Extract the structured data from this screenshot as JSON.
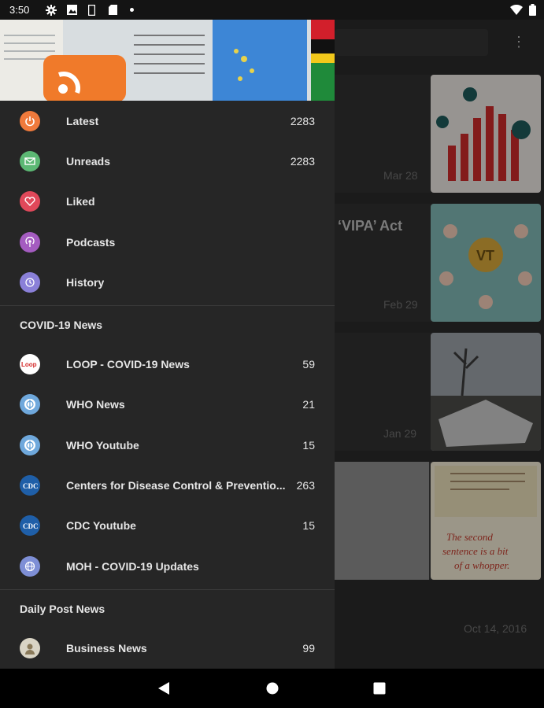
{
  "status": {
    "time": "3:50"
  },
  "menu": [
    {
      "label": "Latest",
      "count": "2283",
      "icon": "power-icon",
      "color": "#f07a3c"
    },
    {
      "label": "Unreads",
      "count": "2283",
      "icon": "envelope-icon",
      "color": "#5cb874"
    },
    {
      "label": "Liked",
      "count": "",
      "icon": "heart-icon",
      "color": "#e0485a"
    },
    {
      "label": "Podcasts",
      "count": "",
      "icon": "podcast-icon",
      "color": "#a45cc0"
    },
    {
      "label": "History",
      "count": "",
      "icon": "history-icon",
      "color": "#8a80d8"
    }
  ],
  "sections": [
    {
      "title": "COVID-19 News",
      "items": [
        {
          "label": "LOOP - COVID-19 News",
          "count": "59",
          "icon": "loop-logo-icon"
        },
        {
          "label": "WHO News",
          "count": "21",
          "icon": "who-logo-icon"
        },
        {
          "label": "WHO Youtube",
          "count": "15",
          "icon": "who-logo-icon"
        },
        {
          "label": "Centers for Disease Control & Preventio...",
          "count": "263",
          "icon": "cdc-logo-icon"
        },
        {
          "label": "CDC Youtube",
          "count": "15",
          "icon": "cdc-logo-icon"
        },
        {
          "label": "MOH - COVID-19 Updates",
          "count": "",
          "icon": "globe-icon"
        }
      ]
    },
    {
      "title": "Daily Post News",
      "items": [
        {
          "label": "Business News",
          "count": "99",
          "icon": "avatar-icon"
        }
      ]
    }
  ],
  "background": {
    "cards": [
      {
        "headline": "",
        "date": "Mar 28"
      },
      {
        "headline": "‘VIPA’ Act",
        "date": "Feb 29"
      },
      {
        "headline": "",
        "date": "Jan 29"
      },
      {
        "headline": "",
        "date": ""
      },
      {
        "headline": "",
        "date": "Oct 14, 2016"
      }
    ]
  }
}
